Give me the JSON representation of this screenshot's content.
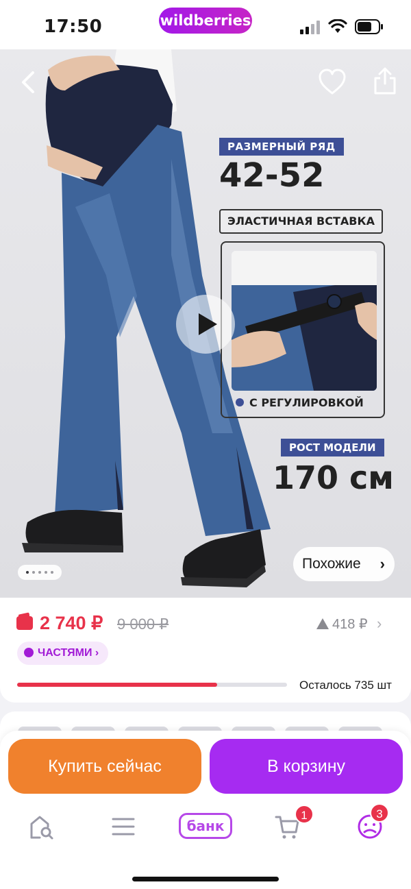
{
  "status_bar": {
    "time": "17:50",
    "brand": "wildberries",
    "icons": [
      "cellular-signal-icon",
      "wifi-icon",
      "battery-icon"
    ]
  },
  "hero": {
    "size_range_label": "РАЗМЕРНЫЙ РЯД",
    "size_range_value": "42-52",
    "elastic_label": "ЭЛАСТИЧНАЯ ВСТАВКА",
    "adjust_label": "С РЕГУЛИРОВКОЙ",
    "model_height_label": "РОСТ МОДЕЛИ",
    "model_height_value": "170 см",
    "similar_button": "Похожие",
    "gallery": {
      "current_index": 1,
      "total_dots": 5
    },
    "icons": [
      "back-arrow-icon",
      "heart-icon",
      "share-icon",
      "play-icon",
      "chevron-right-icon"
    ]
  },
  "price": {
    "current": "2 740 ₽",
    "old": "9 000 ₽",
    "points": "418 ₽",
    "installments_label": "ЧАСТЯМИ",
    "stock_fraction": 0.74,
    "remaining_text": "Осталось 735 шт"
  },
  "actions": {
    "buy_now": "Купить сейчас",
    "add_to_cart": "В корзину"
  },
  "tab_bar": {
    "bank_label": "банк",
    "cart_badge": "1",
    "profile_badge": "3",
    "icons": [
      "home-search-icon",
      "catalog-menu-icon",
      "cart-icon",
      "profile-icon"
    ]
  },
  "colors": {
    "brand_purple": "#a62bf1",
    "buy_orange": "#f0812d",
    "price_red": "#e8324a",
    "tag_blue": "#3d4f96"
  }
}
